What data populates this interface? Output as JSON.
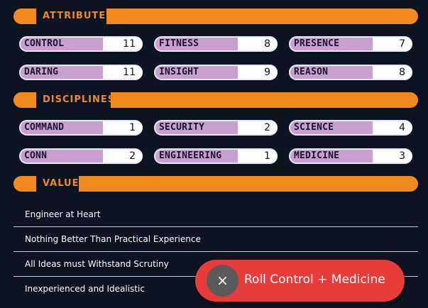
{
  "attributes": {
    "title": "ATTRIBUTES",
    "items": [
      {
        "label": "CONTROL",
        "value": "11"
      },
      {
        "label": "FITNESS",
        "value": "8"
      },
      {
        "label": "PRESENCE",
        "value": "7"
      },
      {
        "label": "DARING",
        "value": "11"
      },
      {
        "label": "INSIGHT",
        "value": "9"
      },
      {
        "label": "REASON",
        "value": "8"
      }
    ]
  },
  "disciplines": {
    "title": "DISCIPLINES",
    "items": [
      {
        "label": "COMMAND",
        "value": "1"
      },
      {
        "label": "SECURITY",
        "value": "2"
      },
      {
        "label": "SCIENCE",
        "value": "4"
      },
      {
        "label": "CONN",
        "value": "2"
      },
      {
        "label": "ENGINEERING",
        "value": "1"
      },
      {
        "label": "MEDICINE",
        "value": "3"
      }
    ]
  },
  "values": {
    "title": "VALUES",
    "items": [
      "Engineer at Heart",
      "Nothing Better Than Practical Experience",
      "All Ideas must Withstand Scrutiny",
      "Inexperienced and Idealistic"
    ]
  },
  "roll_button": {
    "close_glyph": "×",
    "label": "Roll Control + Medicine"
  },
  "colors": {
    "accent": "#f38a1f",
    "stat_label_bg": "#c8a0d0",
    "background": "#0b1420",
    "roll_button": "#e83b3b"
  }
}
